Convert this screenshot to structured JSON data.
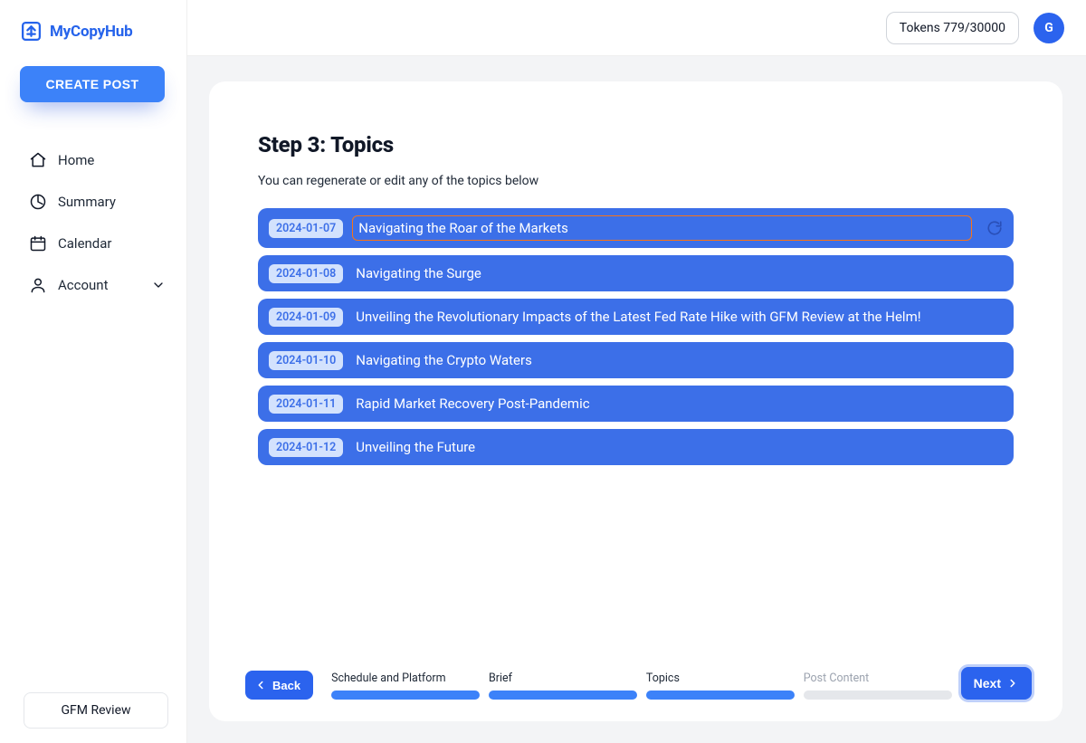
{
  "brand": {
    "name": "MyCopyHub"
  },
  "sidebar": {
    "create_label": "CREATE POST",
    "items": [
      {
        "label": "Home"
      },
      {
        "label": "Summary"
      },
      {
        "label": "Calendar"
      },
      {
        "label": "Account"
      }
    ],
    "footer_project": "GFM Review"
  },
  "header": {
    "tokens_label": "Tokens 779/30000",
    "avatar_initial": "G"
  },
  "main": {
    "title": "Step 3: Topics",
    "subtitle": "You can regenerate or edit any of the topics below",
    "topics": [
      {
        "date": "2024-01-07",
        "title": "Navigating the Roar of the Markets"
      },
      {
        "date": "2024-01-08",
        "title": "Navigating the Surge"
      },
      {
        "date": "2024-01-09",
        "title": "Unveiling the Revolutionary Impacts of the Latest Fed Rate Hike with GFM Review at the Helm!"
      },
      {
        "date": "2024-01-10",
        "title": "Navigating the Crypto Waters"
      },
      {
        "date": "2024-01-11",
        "title": "Rapid Market Recovery Post-Pandemic"
      },
      {
        "date": "2024-01-12",
        "title": "Unveiling the Future"
      }
    ]
  },
  "footer": {
    "back_label": "Back",
    "next_label": "Next",
    "steps": [
      {
        "label": "Schedule and Platform",
        "active": true
      },
      {
        "label": "Brief",
        "active": true
      },
      {
        "label": "Topics",
        "active": true
      },
      {
        "label": "Post Content",
        "active": false
      }
    ]
  }
}
